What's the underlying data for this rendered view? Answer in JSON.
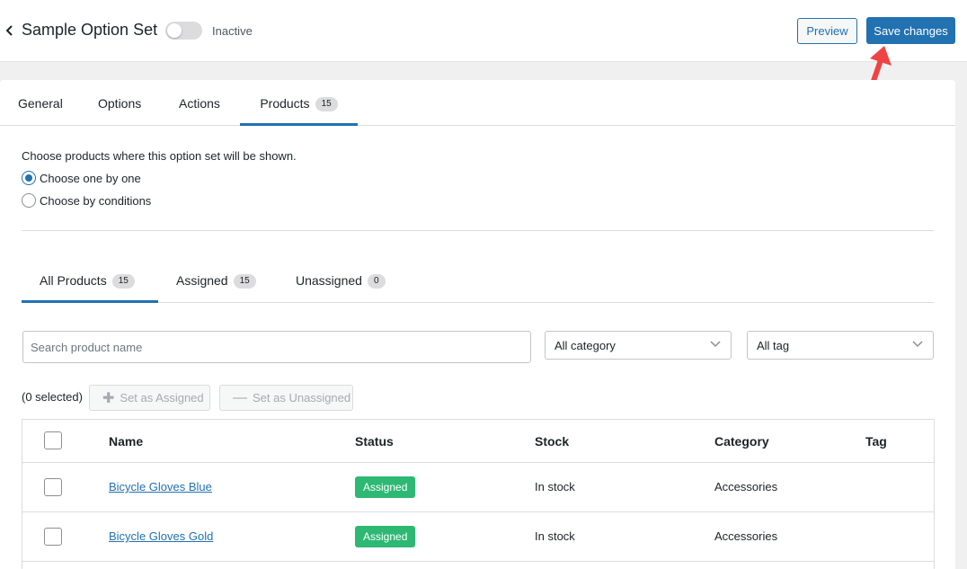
{
  "header": {
    "title": "Sample Option Set",
    "status_label": "Inactive",
    "preview_label": "Preview",
    "save_label": "Save changes"
  },
  "tabs": [
    {
      "label": "General"
    },
    {
      "label": "Options"
    },
    {
      "label": "Actions"
    },
    {
      "label": "Products",
      "count": "15"
    }
  ],
  "products_panel": {
    "description": "Choose products where this option set will be shown.",
    "radio_one": "Choose one by one",
    "radio_conditions": "Choose by conditions",
    "selected_mode": "Choose one by one"
  },
  "subtabs": [
    {
      "label": "All Products",
      "count": "15"
    },
    {
      "label": "Assigned",
      "count": "15"
    },
    {
      "label": "Unassigned",
      "count": "0"
    }
  ],
  "filters": {
    "search_placeholder": "Search product name",
    "category_value": "All category",
    "tag_value": "All tag"
  },
  "bulk": {
    "selected_text": "(0 selected)",
    "assign_label": "Set as Assigned",
    "unassign_label": "Set as Unassigned"
  },
  "table": {
    "columns": [
      "Name",
      "Status",
      "Stock",
      "Category",
      "Tag"
    ],
    "rows": [
      {
        "name": "Bicycle Gloves Blue",
        "status": "Assigned",
        "stock": "In stock",
        "category": "Accessories",
        "tag": ""
      },
      {
        "name": "Bicycle Gloves Gold",
        "status": "Assigned",
        "stock": "In stock",
        "category": "Accessories",
        "tag": ""
      }
    ]
  },
  "colors": {
    "accent": "#2271b1",
    "assigned_badge": "#2db874",
    "annotation_arrow": "#ef4444"
  },
  "icons": {
    "back": "chevron-left-icon",
    "dropdown": "chevron-down-icon",
    "assign": "plus-icon",
    "unassign": "minus-icon"
  }
}
